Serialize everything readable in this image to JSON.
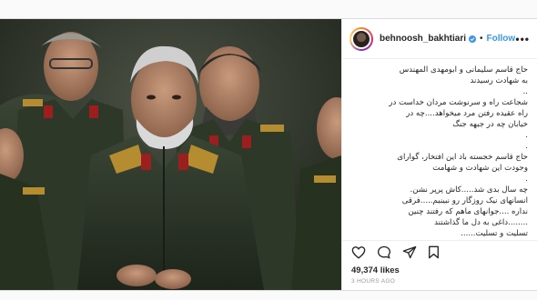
{
  "post": {
    "username": "behnoosh_bakhtiari",
    "follow_label": "Follow",
    "separator": "•",
    "more_label": "•••",
    "caption_lines": [
      "حاج قاسم سلیمانی و ابومهدی المهندس",
      "به شهادت رسیدند",
      "..",
      "شجاعت راه و سرنوشت مردان خداست در",
      "راه عقیده رفتن مرد میخواهد....چه در",
      "خیابان چه در جبهه جنگ",
      ".",
      ".",
      "حاج قاسم خجسته باد این افتخار، گوارای",
      "وجودت این شهادت و شهامت",
      ".",
      "چه سال بدی شد.....کاش پرپر نشن.",
      "انسانهای نیک روزگار رو نبینیم.....فرقی",
      "نداره ....جوانهای ماهم که رفتند چنین",
      "........داغی به دل ما گذاشتند",
      "تسلیت و تسلیت......"
    ],
    "time_ago": "3h",
    "likes": "49,374 likes",
    "posted_ago": "3 HOURS AGO"
  },
  "icons": {
    "verified": "verified-badge-icon",
    "like": "heart-icon",
    "comment": "comment-icon",
    "share": "share-icon",
    "save": "bookmark-icon"
  },
  "colors": {
    "link_blue": "#3897f0",
    "text": "#262626",
    "muted": "#999999",
    "uniform": "#2f3a2a"
  }
}
